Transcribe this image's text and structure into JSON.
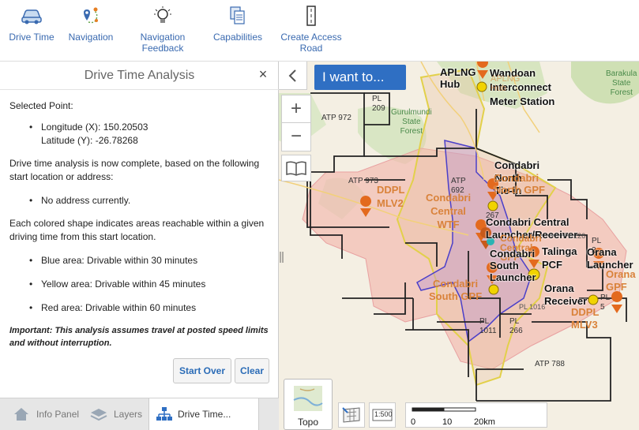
{
  "toolbar": {
    "drive_time": "Drive Time",
    "navigation": "Navigation",
    "navigation_feedback": "Navigation\nFeedback",
    "capabilities": "Capabilities",
    "create_access_road": "Create Access\nRoad"
  },
  "panel": {
    "title": "Drive Time Analysis",
    "close": "×",
    "selected_point": "Selected Point:",
    "longitude": "Longitude (X): 150.20503",
    "latitude": "Latitude (Y): -26.78268",
    "complete_msg": "Drive time analysis is now complete, based on the following start location or address:",
    "no_address": "No address currently.",
    "shapes_msg": "Each colored shape indicates areas reachable within a given driving time from this start location.",
    "blue": "Blue area: Drivable within 30 minutes",
    "yellow": "Yellow area: Drivable within 45 minutes",
    "red": "Red area: Drivable within 60 minutes",
    "important": "Important: This analysis assumes travel at posted speed limits and without interruption.",
    "start_over": "Start Over",
    "clear": "Clear"
  },
  "tabs": {
    "info_panel": "Info Panel",
    "layers": "Layers",
    "drive_time": "Drive Time..."
  },
  "map": {
    "i_want_to": "I want to...",
    "zoom_in": "+",
    "zoom_out": "−",
    "topo": "Topo",
    "scale_button": "1:500",
    "scale_0": "0",
    "scale_10": "10",
    "scale_20": "20km",
    "labels": {
      "aplng_hub": "APLNG\nHub",
      "wandoan": "Wandoan\nInterconnect\nMeter Station",
      "aplng_hub2": "APLNG\nHub",
      "barakula": "Barakula\nState\nForest",
      "gurulmundi": "Gurulmundi\nState\nForest",
      "pl209": "PL\n209",
      "atp972": "ATP 972",
      "atp973": "ATP 973",
      "atp692": "ATP\n692",
      "ddpl_mlv2": "DDPL\nMLV2",
      "condabri_central_wtf": "Condabri\nCentral\nWTF",
      "condabri_north": "Condabri\nNorth\nTie-in",
      "condabri_north_gpf": "Condabri\nNorth GPF",
      "pl267": "267",
      "condabri_central_launcher": "Condabri Central\nLauncher/Receiver",
      "condabri_central_gpf": "Condabri\nCentral\nGPF",
      "talinga_pcf": "Talinga\nPCF",
      "condabri_south_launcher": "Condabri\nSouth\nLauncher",
      "condabri_south_gpf": "Condabri\nSouth GPF",
      "orana_launcher": "Orana\nLauncher",
      "orana_gpf": "Orana\nGPF",
      "orana_receiver": "Orana\nReceiver",
      "ddpl_mlv3": "DDPL\nMLV3",
      "pl2": "PL\n2",
      "pl5": "PL\n5",
      "pl1011": "PL\n1011",
      "pl266": "PL\n266",
      "pl1016": "PL 1016",
      "pl226": "PL 226",
      "atp788": "ATP 788"
    }
  }
}
